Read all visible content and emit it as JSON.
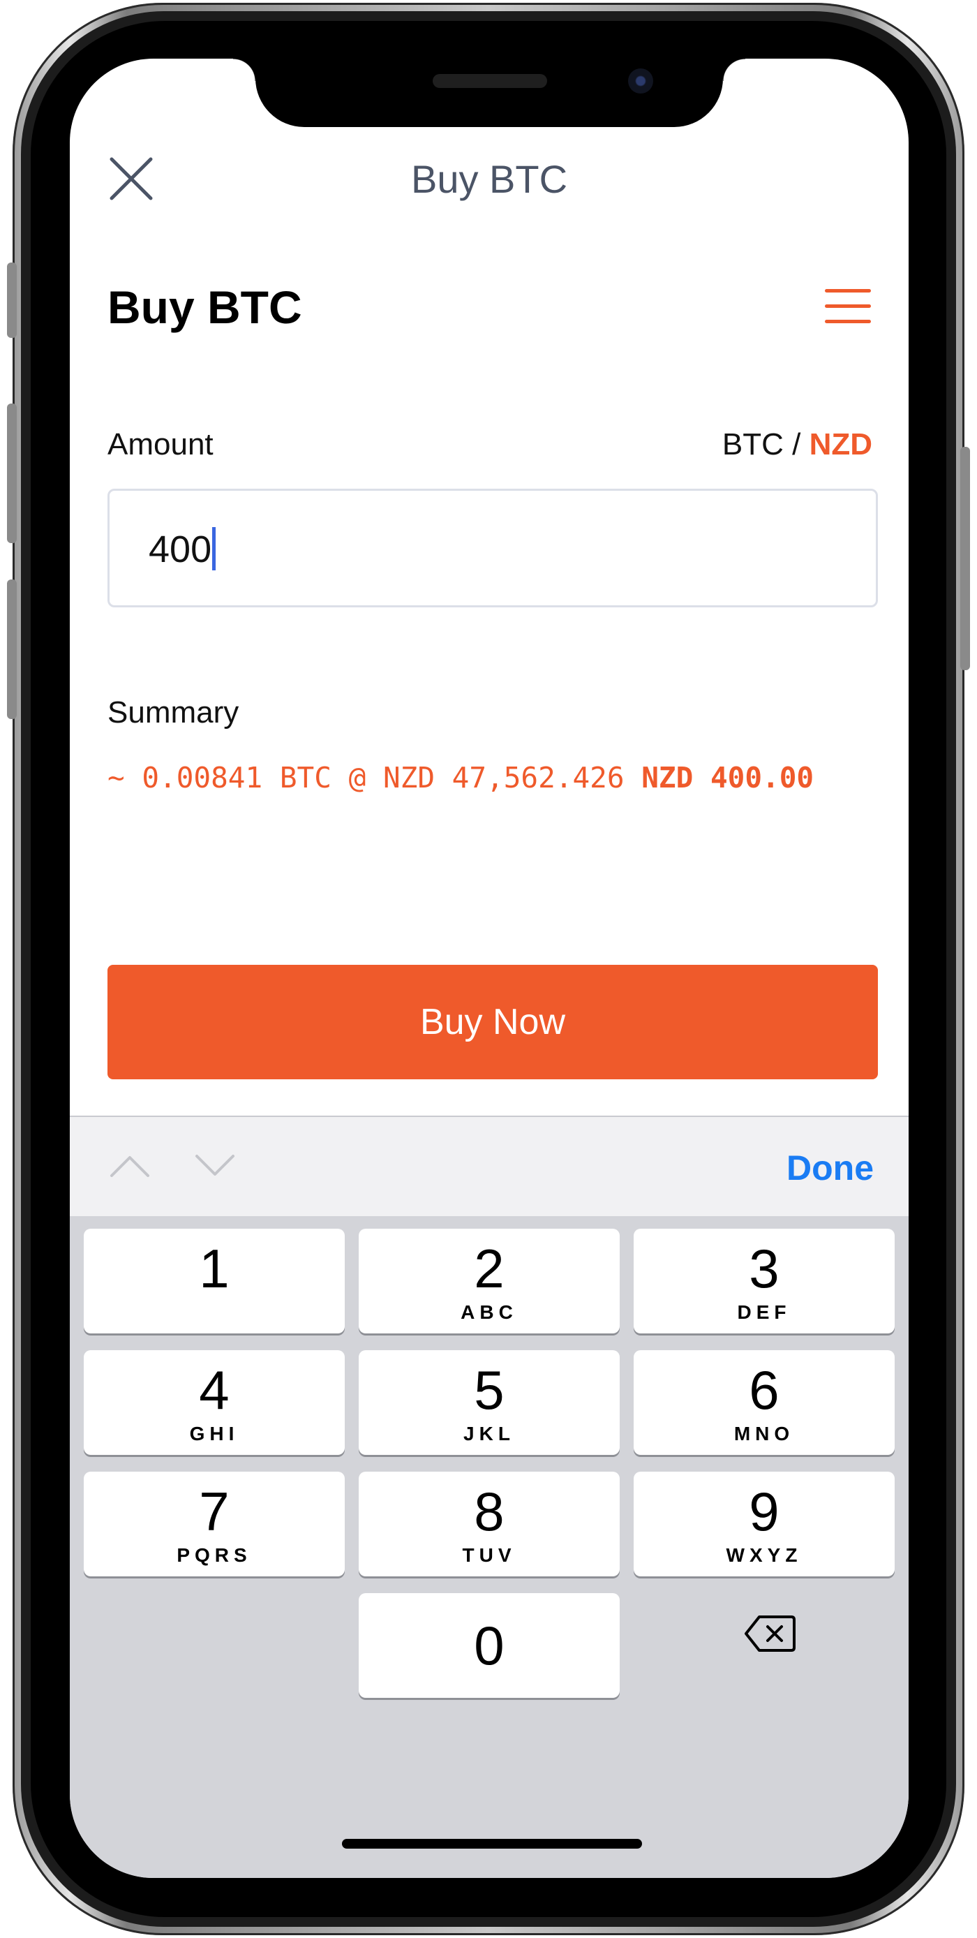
{
  "header": {
    "nav_title": "Buy BTC",
    "page_title": "Buy BTC",
    "close_icon": "close-icon",
    "menu_icon": "hamburger-menu-icon"
  },
  "amount": {
    "label": "Amount",
    "currency_base": "BTC",
    "currency_separator": " / ",
    "currency_active": "NZD",
    "value": "400"
  },
  "summary": {
    "label": "Summary",
    "estimate": "~ 0.00841 BTC @ NZD 47,562.426",
    "total": "NZD 400.00"
  },
  "actions": {
    "buy_label": "Buy Now"
  },
  "keyboard": {
    "done_label": "Done",
    "keys": [
      {
        "digit": "1",
        "letters": ""
      },
      {
        "digit": "2",
        "letters": "ABC"
      },
      {
        "digit": "3",
        "letters": "DEF"
      },
      {
        "digit": "4",
        "letters": "GHI"
      },
      {
        "digit": "5",
        "letters": "JKL"
      },
      {
        "digit": "6",
        "letters": "MNO"
      },
      {
        "digit": "7",
        "letters": "PQRS"
      },
      {
        "digit": "8",
        "letters": "TUV"
      },
      {
        "digit": "9",
        "letters": "WXYZ"
      },
      {
        "digit": "0",
        "letters": ""
      }
    ]
  },
  "colors": {
    "accent": "#ef5a2b",
    "link": "#1a7cf3",
    "caret": "#3a66e0"
  }
}
